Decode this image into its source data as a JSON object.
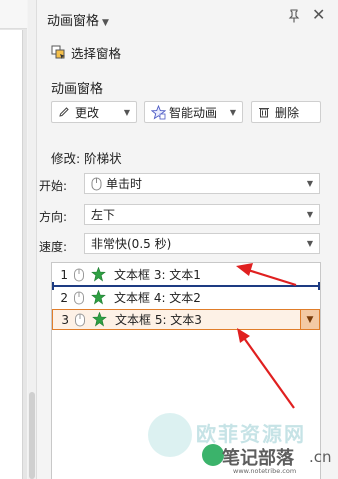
{
  "panel": {
    "title": "动画窗格",
    "select_pane": "选择窗格"
  },
  "section": {
    "title": "动画窗格"
  },
  "buttons": {
    "change": "更改",
    "smart_anim": "智能动画",
    "delete": "删除"
  },
  "modify": {
    "label": "修改: 阶梯状"
  },
  "start": {
    "label": "开始:",
    "value": "单击时"
  },
  "direction": {
    "label": "方向:",
    "value": "左下"
  },
  "speed": {
    "label": "速度:",
    "value": "非常快(0.5 秒)"
  },
  "animations": [
    {
      "num": "1",
      "name": "文本框 3: 文本1"
    },
    {
      "num": "2",
      "name": "文本框 4: 文本2"
    },
    {
      "num": "3",
      "name": "文本框 5: 文本3"
    }
  ],
  "watermark": {
    "line1": "欧菲资源网",
    "line2": "笔记部落",
    "suffix": ".cn",
    "url": "www.notetribe.com"
  },
  "colors": {
    "selection_border": "#e07d2a",
    "arrow": "#e02020",
    "insert_line": "#1d3b82",
    "star": "#2fa043"
  }
}
